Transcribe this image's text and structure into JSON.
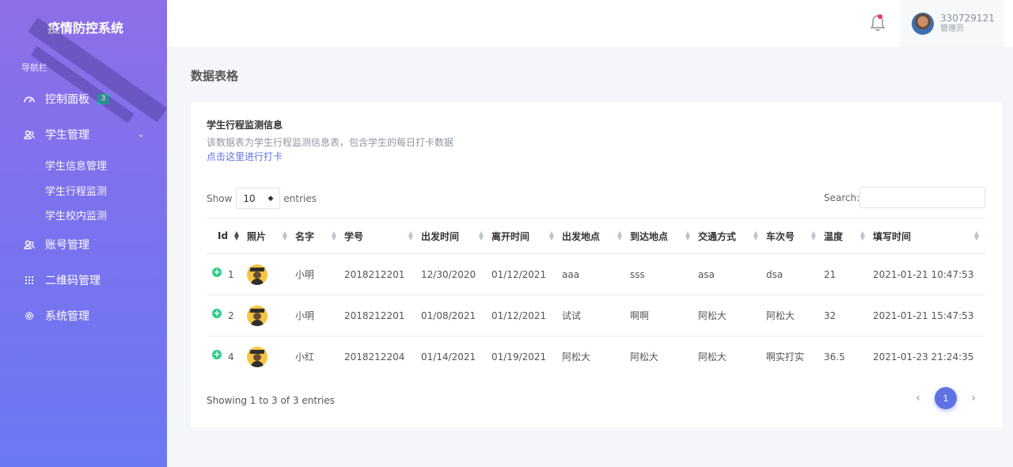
{
  "sidebar": {
    "brand": "疫情防控系统",
    "section_label": "导航栏",
    "items": [
      {
        "label": "控制面板",
        "icon": "gauge-icon",
        "badge": "3"
      },
      {
        "label": "学生管理",
        "icon": "users-icon"
      },
      {
        "label": "账号管理",
        "icon": "users-icon"
      },
      {
        "label": "二维码管理",
        "icon": "grid-icon"
      },
      {
        "label": "系统管理",
        "icon": "gear-icon"
      }
    ],
    "sub_items": [
      "学生信息管理",
      "学生行程监测",
      "学生校内监测"
    ]
  },
  "header": {
    "user_name": "330729121",
    "user_role": "管理员"
  },
  "page": {
    "title": "数据表格"
  },
  "card": {
    "title": "学生行程监测信息",
    "description": "该数据表为学生行程监测信息表，包含学生的每日打卡数据",
    "link": "点击这里进行打卡",
    "show_label": "Show",
    "length_value": "10",
    "entries_label": "entries",
    "search_label": "Search:",
    "columns": [
      "Id",
      "照片",
      "名字",
      "学号",
      "出发时间",
      "离开时间",
      "出发地点",
      "到达地点",
      "交通方式",
      "车次号",
      "温度",
      "填写时间"
    ],
    "rows": [
      {
        "id": "1",
        "name": "小明",
        "student_no": "2018212201",
        "depart_time": "12/30/2020",
        "leave_time": "01/12/2021",
        "from": "aaa",
        "to": "sss",
        "transport": "asa",
        "train_no": "dsa",
        "temp": "21",
        "filled_at": "2021-01-21 10:47:53"
      },
      {
        "id": "2",
        "name": "小明",
        "student_no": "2018212201",
        "depart_time": "01/08/2021",
        "leave_time": "01/12/2021",
        "from": "试试",
        "to": "啊啊",
        "transport": "阿松大",
        "train_no": "阿松大",
        "temp": "32",
        "filled_at": "2021-01-21 15:47:53"
      },
      {
        "id": "4",
        "name": "小红",
        "student_no": "2018212204",
        "depart_time": "01/14/2021",
        "leave_time": "01/19/2021",
        "from": "阿松大",
        "to": "阿松大",
        "transport": "阿松大",
        "train_no": "啊实打实",
        "temp": "36.5",
        "filled_at": "2021-01-23 21:24:35"
      }
    ],
    "info": "Showing 1 to 3 of 3 entries",
    "pagination": {
      "prev": "‹",
      "current": "1",
      "next": "›"
    }
  },
  "colors": {
    "sidebar_top": "#8e6ee8",
    "sidebar_bottom": "#6c78f2",
    "accent": "#5e72e4",
    "badge": "#22c39f",
    "notification_dot": "#f5365c"
  }
}
